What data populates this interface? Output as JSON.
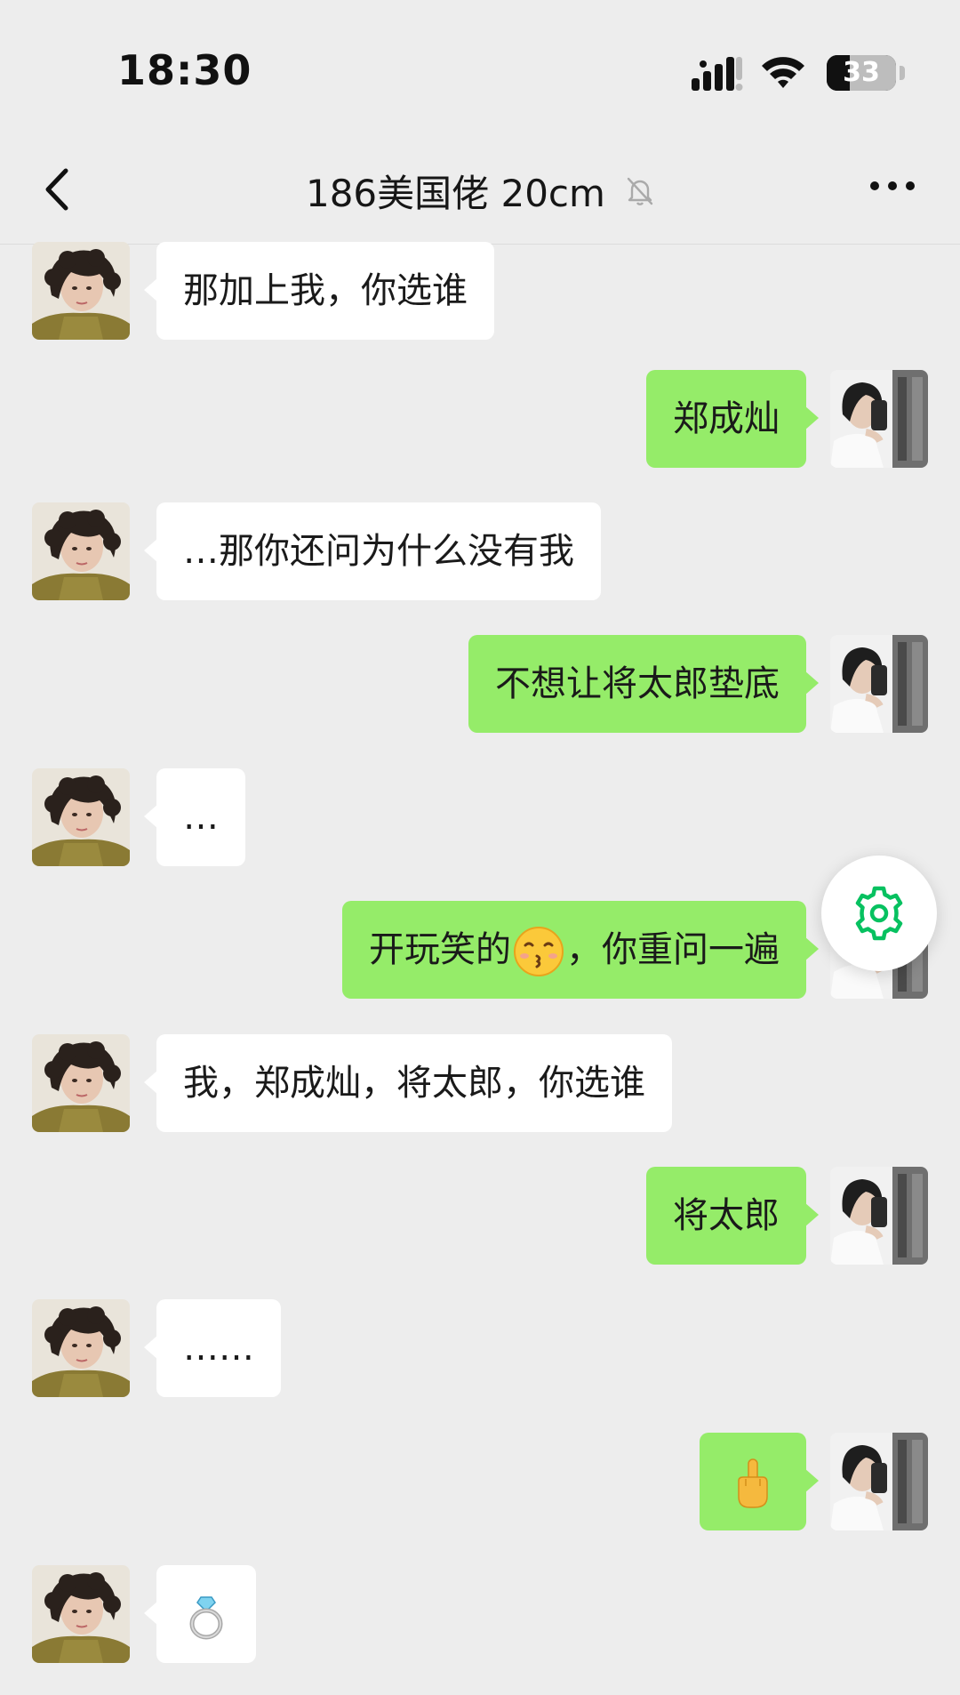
{
  "status_bar": {
    "time": "18:30",
    "battery_level": "33"
  },
  "header": {
    "title": "186美国佬 20cm"
  },
  "messages": [
    {
      "side": "in",
      "text": "那加上我，你选谁"
    },
    {
      "side": "out",
      "text": "郑成灿"
    },
    {
      "side": "in",
      "text": "…那你还问为什么没有我"
    },
    {
      "side": "out",
      "text": "不想让将太郎垫底"
    },
    {
      "side": "in",
      "text": "…"
    },
    {
      "side": "out",
      "text_before": "开玩笑的",
      "text_after": "，你重问一遍",
      "emoji": "kissing-face-emoji"
    },
    {
      "side": "in",
      "text": "我，郑成灿，将太郎，你选谁"
    },
    {
      "side": "out",
      "text": "将太郎"
    },
    {
      "side": "in",
      "text": "……"
    },
    {
      "side": "out",
      "emoji": "middle-finger-emoji"
    },
    {
      "side": "in",
      "emoji": "ring-emoji"
    }
  ],
  "colors": {
    "background": "#ededed",
    "outgoing_bubble": "#95ec69",
    "incoming_bubble": "#ffffff",
    "fab_icon": "#07c160"
  }
}
